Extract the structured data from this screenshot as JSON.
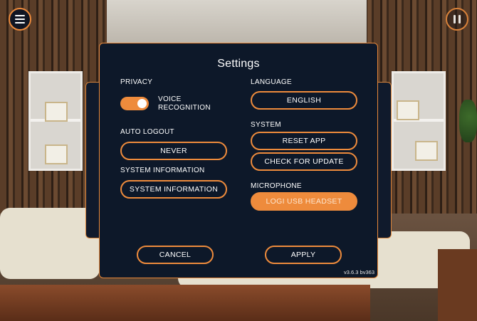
{
  "dialog": {
    "title": "Settings",
    "version": "v3.6.3 bv363"
  },
  "privacy": {
    "label": "PRIVACY",
    "voice_recognition_label": "VOICE RECOGNITION",
    "voice_recognition_enabled": true
  },
  "auto_logout": {
    "label": "AUTO LOGOUT",
    "value": "NEVER"
  },
  "system_information": {
    "label": "SYSTEM INFORMATION",
    "button": "SYSTEM INFORMATION"
  },
  "language": {
    "label": "LANGUAGE",
    "value": "ENGLISH"
  },
  "system": {
    "label": "SYSTEM",
    "reset_button": "RESET APP",
    "update_button": "CHECK FOR UPDATE"
  },
  "microphone": {
    "label": "MICROPHONE",
    "value": "LOGI USB HEADSET"
  },
  "footer": {
    "cancel": "CANCEL",
    "apply": "APPLY"
  },
  "icons": {
    "menu": "hamburger-menu-icon",
    "pause": "pause-icon"
  },
  "colors": {
    "accent": "#ee8b3c",
    "dialog_bg": "#0d1829"
  }
}
